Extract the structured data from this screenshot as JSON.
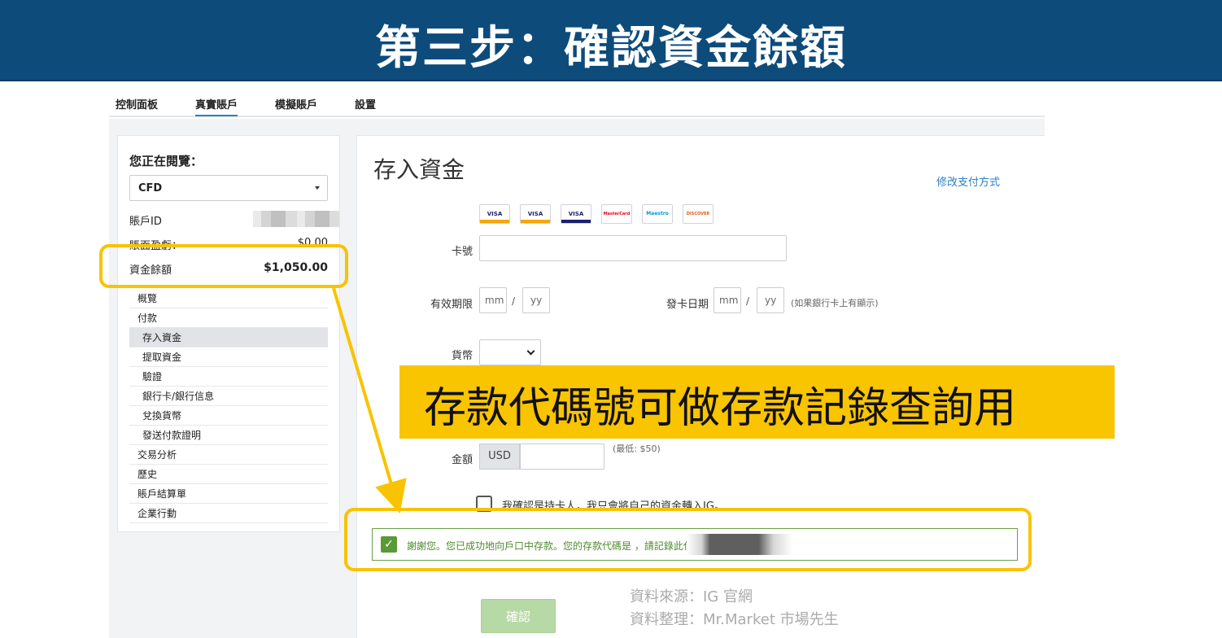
{
  "banner": {
    "title": "第三步：確認資金餘額"
  },
  "topnav": {
    "tabs": [
      {
        "label": "控制面板"
      },
      {
        "label": "真實賬戶"
      },
      {
        "label": "模擬賬戶"
      },
      {
        "label": "設置"
      }
    ],
    "active_tab": "真實賬戶"
  },
  "sidebar": {
    "heading": "您正在閱覽：",
    "account_select": {
      "value": "CFD"
    },
    "rows": [
      {
        "key": "賬戶ID",
        "value": ""
      },
      {
        "key": "賬面盈虧：",
        "value": "$0.00"
      },
      {
        "key": "資金餘額",
        "value": "$1,050.00"
      }
    ],
    "menu": [
      {
        "label": "概覽"
      },
      {
        "label": "付款"
      },
      {
        "label": "存入資金"
      },
      {
        "label": "提取資金"
      },
      {
        "label": "驗證"
      },
      {
        "label": "銀行卡/銀行信息"
      },
      {
        "label": "兌換貨幣"
      },
      {
        "label": "發送付款證明"
      },
      {
        "label": "交易分析"
      },
      {
        "label": "歷史"
      },
      {
        "label": "賬戶結算單"
      },
      {
        "label": "企業行動"
      }
    ],
    "active_menu": "存入資金"
  },
  "main": {
    "title": "存入資金",
    "change_payment_link": "修改支付方式",
    "card_logos": [
      {
        "name": "VISA",
        "color": "#1a1f71",
        "accent": "#f7a600"
      },
      {
        "name": "VISA",
        "color": "#1a1f71",
        "accent": "#f7a600"
      },
      {
        "name": "VISA",
        "color": "#1a1f71",
        "accent": "#1a1f71"
      },
      {
        "name": "MasterCard",
        "color": "#eb001b",
        "accent": "#f79e1b"
      },
      {
        "name": "Maestro",
        "color": "#0099df",
        "accent": "#eb001b"
      },
      {
        "name": "DISCOVER",
        "color": "#e55c20",
        "accent": "#e55c20"
      }
    ],
    "card_number_label": "卡號",
    "expiry_label": "有效期限",
    "expiry_mm": "mm",
    "expiry_yy": "yy",
    "issue_label": "發卡日期",
    "issue_mm": "mm",
    "issue_yy": "yy",
    "issue_hint": "(如果銀行卡上有顯示)",
    "currency_label": "貨幣",
    "amount_label": "金額",
    "amount_currency": "USD",
    "amount_hint": "(最低: $50)",
    "confirm_text": "我確認是持卡人，我只會將自己的資金轉入IG。",
    "success_message": "謝謝您。您已成功地向戶口中存款。您的存款代碼是                                   ，請記錄此代碼號做查詢用。",
    "submit_label": "確認"
  },
  "callout": {
    "text": "存款代碼號可做存款記錄查詢用"
  },
  "source": {
    "line1": "資料來源：IG 官網",
    "line2": "資料整理：Mr.Market 市場先生"
  },
  "colors": {
    "banner": "#0d4b7b",
    "highlight": "#f8c300",
    "link": "#2a7fc4",
    "success": "#5a9a36"
  }
}
